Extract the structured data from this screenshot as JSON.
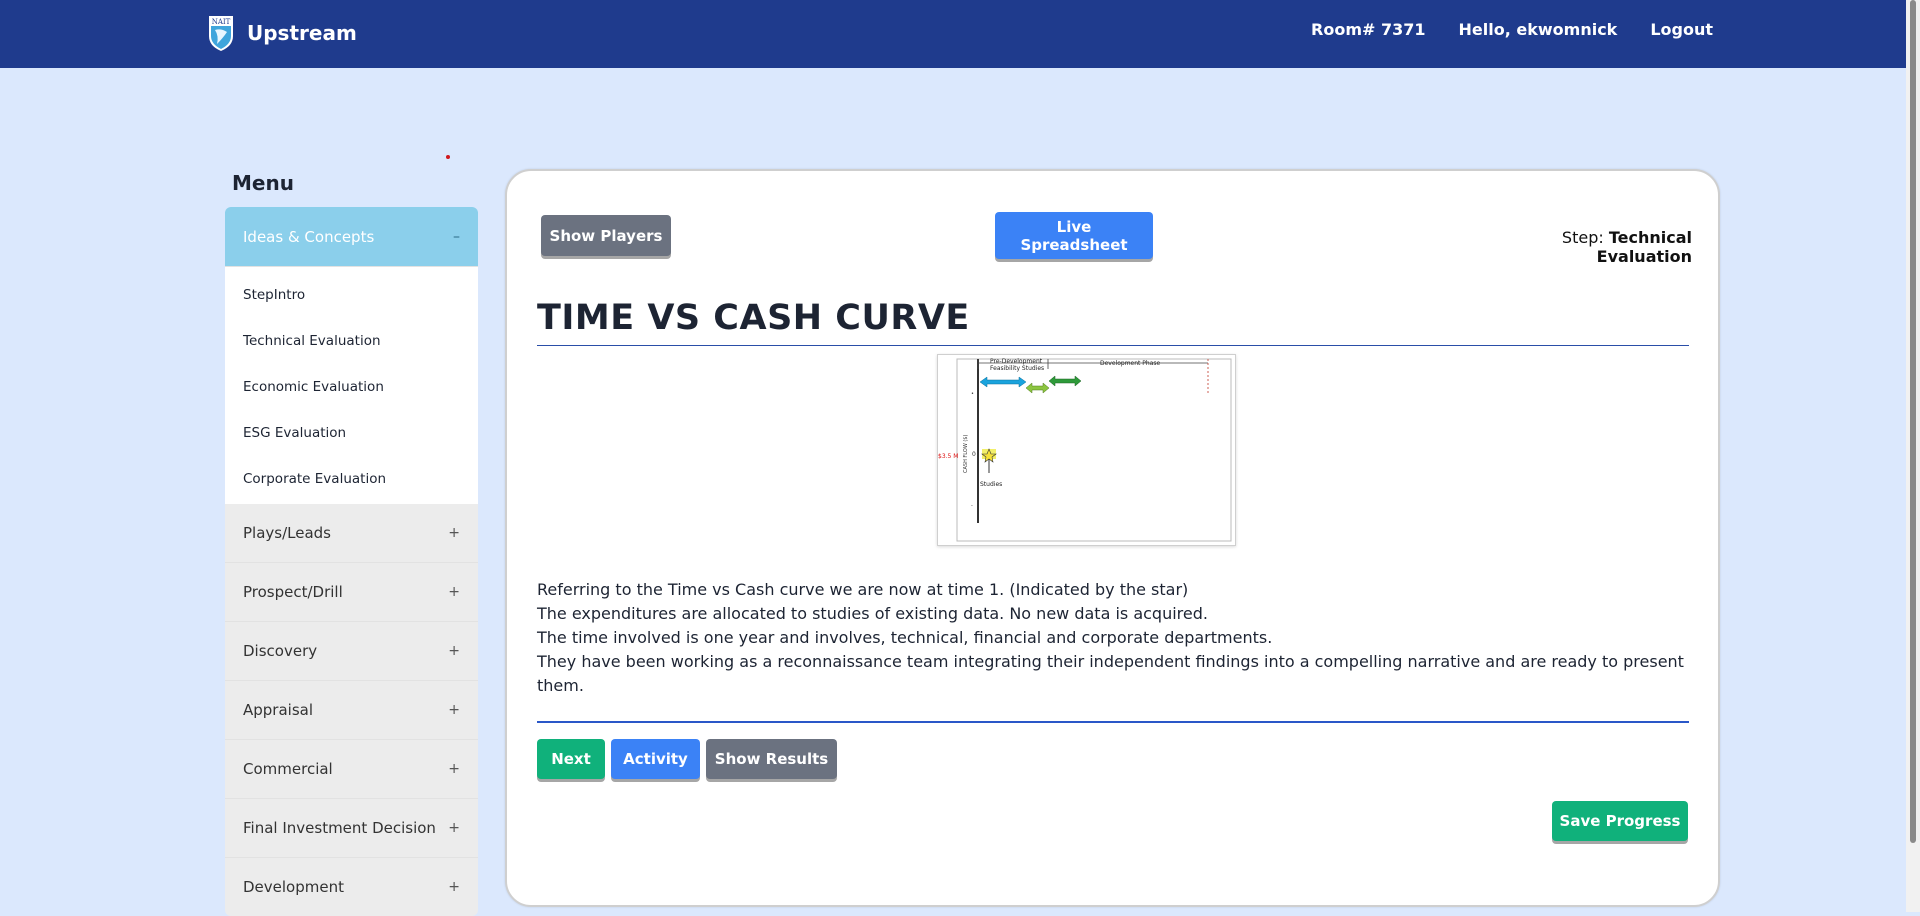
{
  "header": {
    "app_name": "Upstream",
    "logo_text": "NAIT",
    "room": "Room# 7371",
    "greeting": "Hello, ekwomnick",
    "logout": "Logout"
  },
  "menu": {
    "title": "Menu",
    "sections": [
      {
        "label": "Ideas & Concepts",
        "sign": "–",
        "open": true,
        "items": [
          "StepIntro",
          "Technical Evaluation",
          "Economic Evaluation",
          "ESG Evaluation",
          "Corporate Evaluation"
        ]
      },
      {
        "label": "Plays/Leads",
        "sign": "+"
      },
      {
        "label": "Prospect/Drill",
        "sign": "+"
      },
      {
        "label": "Discovery",
        "sign": "+"
      },
      {
        "label": "Appraisal",
        "sign": "+"
      },
      {
        "label": "Commercial",
        "sign": "+"
      },
      {
        "label": "Final Investment Decision",
        "sign": "+"
      },
      {
        "label": "Development",
        "sign": "+"
      }
    ]
  },
  "content": {
    "show_players": "Show Players",
    "live_spreadsheet": "Live Spreadsheet",
    "step_prefix": "Step:",
    "step_name": "Technical Evaluation",
    "title": "TIME VS CASH CURVE",
    "figure": {
      "pre_development": "Pre-Development",
      "feasibility": "Feasibility Studies",
      "development_phase": "Development Phase",
      "y_axis": "CASH FLOW ($)",
      "amount": "$3.5 M",
      "zero": "0",
      "studies": "Studies"
    },
    "paragraphs": [
      "Referring to the Time vs Cash curve we are now at time 1. (Indicated by the star)",
      "The expenditures are allocated to studies of existing data. No new data is acquired.",
      "The time involved is one year and involves, technical, financial and corporate departments.",
      "They have been working as a reconnaissance team integrating their independent findings into a compelling narrative and are ready to present them."
    ],
    "next": "Next",
    "activity": "Activity",
    "show_results": "Show Results",
    "save_progress": "Save Progress"
  }
}
